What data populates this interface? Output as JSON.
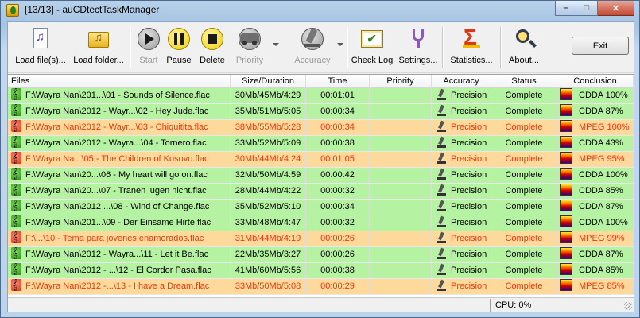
{
  "window": {
    "title": "[13/13] - auCDtectTaskManager",
    "minimize_glyph": "–",
    "maximize_glyph": "□",
    "close_glyph": "✕"
  },
  "toolbar": {
    "buttons": [
      {
        "label": "Load file(s)...",
        "icon": "music-document-icon",
        "enabled": true
      },
      {
        "label": "Load folder...",
        "icon": "music-folder-icon",
        "enabled": true
      },
      {
        "label": "Start",
        "icon": "play-icon",
        "enabled": false
      },
      {
        "label": "Pause",
        "icon": "pause-icon",
        "enabled": true
      },
      {
        "label": "Delete",
        "icon": "stop-icon",
        "enabled": true
      },
      {
        "label": "Priority",
        "icon": "car-icon",
        "enabled": false
      },
      {
        "label": "Accuracy",
        "icon": "microscope-icon",
        "enabled": false
      },
      {
        "label": "Check Log",
        "icon": "checklist-icon",
        "enabled": true
      },
      {
        "label": "Settings...",
        "icon": "tuning-fork-icon",
        "enabled": true
      },
      {
        "label": "Statistics...",
        "icon": "sigma-icon",
        "enabled": true
      },
      {
        "label": "About...",
        "icon": "magnifier-icon",
        "enabled": true
      }
    ],
    "exit_label": "Exit"
  },
  "columns": [
    "Files",
    "Size/Duration",
    "Time",
    "Priority",
    "Accuracy",
    "Status",
    "Conclusion"
  ],
  "rows": [
    {
      "file": "F:\\Wayra Nan\\201...\\01 - Sounds of Silence.flac",
      "size": "30Mb/45Mb/4:29",
      "time": "00:01:01",
      "priority": "",
      "accuracy": "Precision",
      "status": "Complete",
      "conclusion": "CDDA 100%",
      "state": "ok"
    },
    {
      "file": "F:\\Wayra Nan\\2012 - Wayr...\\02 - Hey Jude.flac",
      "size": "35Mb/51Mb/5:05",
      "time": "00:00:34",
      "priority": "",
      "accuracy": "Precision",
      "status": "Complete",
      "conclusion": "CDDA 87%",
      "state": "ok"
    },
    {
      "file": "F:\\Wayra Nan\\2012 - Wayr...\\03 - Chiquitita.flac",
      "size": "38Mb/55Mb/5:28",
      "time": "00:00:34",
      "priority": "",
      "accuracy": "Precision",
      "status": "Complete",
      "conclusion": "MPEG 100%",
      "state": "warn"
    },
    {
      "file": "F:\\Wayra Nan\\2012 - Wayra...\\04 - Tornero.flac",
      "size": "33Mb/52Mb/5:09",
      "time": "00:00:38",
      "priority": "",
      "accuracy": "Precision",
      "status": "Complete",
      "conclusion": "CDDA 43%",
      "state": "ok"
    },
    {
      "file": "F:\\Wayra Na...\\05 - The Children of Kosovo.flac",
      "size": "30Mb/44Mb/4:24",
      "time": "00:01:05",
      "priority": "",
      "accuracy": "Precision",
      "status": "Complete",
      "conclusion": "MPEG 95%",
      "state": "warn"
    },
    {
      "file": "F:\\Wayra Nan\\20...\\06 - My heart will go on.flac",
      "size": "32Mb/50Mb/4:59",
      "time": "00:00:42",
      "priority": "",
      "accuracy": "Precision",
      "status": "Complete",
      "conclusion": "CDDA 100%",
      "state": "ok"
    },
    {
      "file": "F:\\Wayra Nan\\20...\\07 - Tranen lugen nicht.flac",
      "size": "28Mb/44Mb/4:22",
      "time": "00:00:32",
      "priority": "",
      "accuracy": "Precision",
      "status": "Complete",
      "conclusion": "CDDA 85%",
      "state": "ok"
    },
    {
      "file": "F:\\Wayra Nan\\2012 ...\\08 - Wind of Change.flac",
      "size": "35Mb/52Mb/5:10",
      "time": "00:00:34",
      "priority": "",
      "accuracy": "Precision",
      "status": "Complete",
      "conclusion": "CDDA 87%",
      "state": "ok"
    },
    {
      "file": "F:\\Wayra Nan\\201...\\09 - Der Einsame Hirte.flac",
      "size": "33Mb/48Mb/4:47",
      "time": "00:00:32",
      "priority": "",
      "accuracy": "Precision",
      "status": "Complete",
      "conclusion": "CDDA 100%",
      "state": "ok"
    },
    {
      "file": "F:\\...\\10 - Tema para jovenes enamorados.flac",
      "size": "31Mb/44Mb/4:19",
      "time": "00:00:26",
      "priority": "",
      "accuracy": "Precision",
      "status": "Complete",
      "conclusion": "MPEG 99%",
      "state": "warn"
    },
    {
      "file": "F:\\Wayra Nan\\2012 - Wayra...\\11 - Let it Be.flac",
      "size": "22Mb/35Mb/3:27",
      "time": "00:00:26",
      "priority": "",
      "accuracy": "Precision",
      "status": "Complete",
      "conclusion": "CDDA 87%",
      "state": "ok"
    },
    {
      "file": "F:\\Wayra Nan\\2012 - ...\\12 - El Cordor Pasa.flac",
      "size": "41Mb/60Mb/5:56",
      "time": "00:00:38",
      "priority": "",
      "accuracy": "Precision",
      "status": "Complete",
      "conclusion": "CDDA 85%",
      "state": "ok"
    },
    {
      "file": "F:\\Wayra Nan\\2012 -...\\13 - I have a Dream.flac",
      "size": "33Mb/50Mb/5:08",
      "time": "00:00:29",
      "priority": "",
      "accuracy": "Precision",
      "status": "Complete",
      "conclusion": "MPEG 85%",
      "state": "warn"
    }
  ],
  "statusbar": {
    "cpu": "CPU: 0%"
  },
  "colors": {
    "ok_row": "#b5f3a2",
    "warn_row": "#fed99c",
    "warn_text": "#e63b0f"
  }
}
